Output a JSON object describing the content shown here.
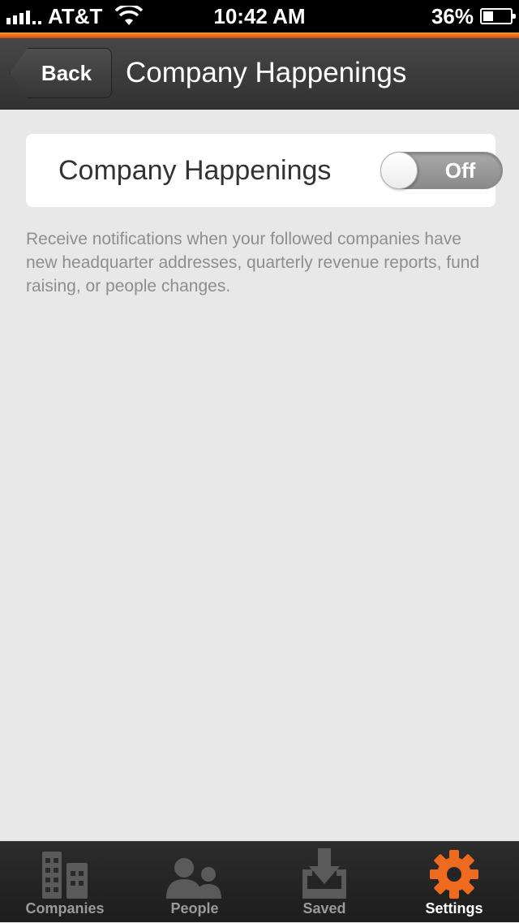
{
  "status_bar": {
    "carrier": "AT&T",
    "time": "10:42 AM",
    "battery": "36%",
    "battery_level": 0.36
  },
  "nav": {
    "back_label": "Back",
    "title": "Company Happenings"
  },
  "setting": {
    "label": "Company Happenings",
    "toggle_label": "Off",
    "enabled": false,
    "description": "Receive notifications when your followed companies have new headquarter addresses, quarterly revenue reports, fund raising, or people changes."
  },
  "tabs": [
    {
      "label": "Companies",
      "icon": "buildings-icon",
      "active": false
    },
    {
      "label": "People",
      "icon": "people-icon",
      "active": false
    },
    {
      "label": "Saved",
      "icon": "download-tray-icon",
      "active": false
    },
    {
      "label": "Settings",
      "icon": "gear-icon",
      "active": true
    }
  ],
  "colors": {
    "accent": "#ee6a1e",
    "tab_inactive_icon": "#5a5a5a",
    "background": "#e8e8e8"
  }
}
